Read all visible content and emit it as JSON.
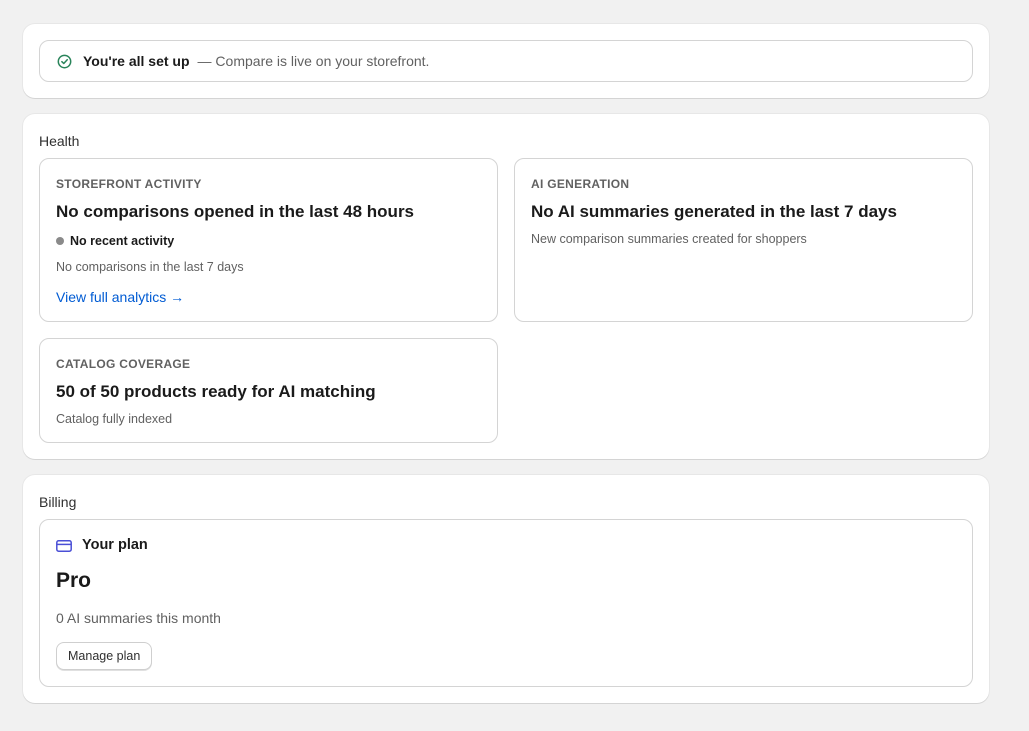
{
  "setup": {
    "title": "You're all set up",
    "subtitle": "— Compare is live on your storefront.",
    "icon": "check-circle-icon"
  },
  "health": {
    "section_title": "Health",
    "storefront": {
      "label": "STOREFRONT ACTIVITY",
      "heading": "No comparisons opened in the last 48 hours",
      "status": "No recent activity",
      "status_color": "#8a8a8a",
      "detail": "No comparisons in the last 7 days",
      "link": "View full analytics →"
    },
    "ai": {
      "label": "AI GENERATION",
      "heading": "No AI summaries generated in the last 7 days",
      "detail": "New comparison summaries created for shoppers"
    },
    "catalog": {
      "label": "CATALOG COVERAGE",
      "heading": "50 of 50 products ready for AI matching",
      "detail": "Catalog fully indexed"
    }
  },
  "billing": {
    "section_title": "Billing",
    "plan_title": "Your plan",
    "plan_icon": "credit-card-icon",
    "plan_name": "Pro",
    "usage": "0 AI summaries this month",
    "manage_label": "Manage plan"
  },
  "colors": {
    "accent_link": "#005bd3",
    "success": "#29845a",
    "card_icon": "#4a4fd6"
  }
}
